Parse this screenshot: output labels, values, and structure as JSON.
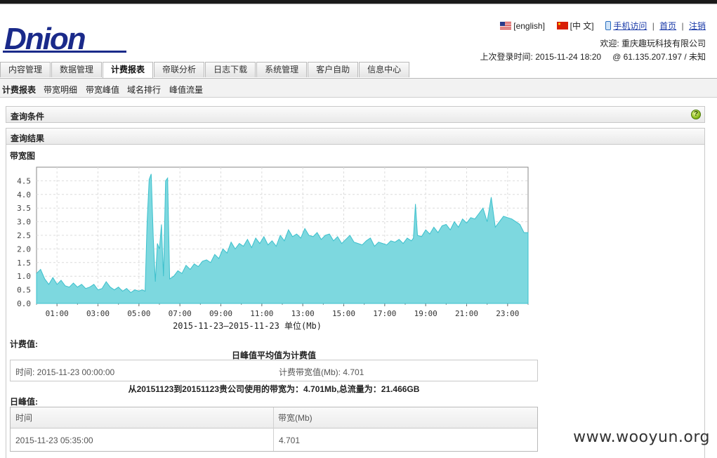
{
  "brand": {
    "logo_text": "Dnion"
  },
  "header": {
    "lang_english": "[english]",
    "lang_chinese": "[中 文]",
    "mobile": "手机访问",
    "home": "首页",
    "logout": "注销",
    "sep": "|",
    "welcome": "欢迎: 重庆趣玩科技有限公司",
    "last_login": "上次登录时间: 2015-11-24 18:20",
    "ip": "@ 61.135.207.197 / 未知"
  },
  "tabs": [
    "内容管理",
    "数据管理",
    "计费报表",
    "帝联分析",
    "日志下载",
    "系统管理",
    "客户自助",
    "信息中心"
  ],
  "active_tab": 2,
  "subnav": [
    "计费报表",
    "带宽明细",
    "带宽峰值",
    "域名排行",
    "峰值流量"
  ],
  "panels": {
    "query": "查询条件",
    "result": "查询结果"
  },
  "labels": {
    "chart": "带宽图",
    "billing": "计费值:",
    "daily_peak": "日峰值:"
  },
  "billing": {
    "rule": "日峰值平均值为计费值",
    "time": "时间: 2015-11-23 00:00:00",
    "value": "计费带宽值(Mb): 4.701",
    "summary": "从20151123到20151123贵公司使用的带宽为：4.701Mb,总流量为：21.466GB"
  },
  "peak_table": {
    "headers": [
      "时间",
      "带宽(Mb)"
    ],
    "rows": [
      [
        "2015-11-23 05:35:00",
        "4.701"
      ]
    ]
  },
  "watermark": "www.wooyun.org",
  "colors": {
    "fill": "#7dd8df",
    "stroke": "#3cc0cc",
    "logo": "#1a2a8a",
    "link": "#1a3aa8"
  },
  "chart_data": {
    "type": "area",
    "xlabel": "2015-11-23—2015-11-23 单位(Mb)",
    "ylabel": "",
    "ylim": [
      0,
      5
    ],
    "xlim": [
      0,
      24
    ],
    "grid": true,
    "xticks": [
      "01:00",
      "03:00",
      "05:00",
      "07:00",
      "09:00",
      "11:00",
      "13:00",
      "15:00",
      "17:00",
      "19:00",
      "21:00",
      "23:00"
    ],
    "yticks": [
      "0.0",
      "0.5",
      "1.0",
      "1.5",
      "2.0",
      "2.5",
      "3.0",
      "3.5",
      "4.0",
      "4.5"
    ],
    "series": [
      {
        "x": [
          0,
          0.2,
          0.4,
          0.6,
          0.8,
          1,
          1.2,
          1.4,
          1.6,
          1.8,
          2,
          2.2,
          2.4,
          2.6,
          2.8,
          3,
          3.2,
          3.4,
          3.6,
          3.8,
          4,
          4.2,
          4.4,
          4.6,
          4.8,
          5,
          5.15,
          5.3,
          5.4,
          5.5,
          5.6,
          5.7,
          5.8,
          5.9,
          6.0,
          6.1,
          6.2,
          6.3,
          6.4,
          6.5,
          6.7,
          6.9,
          7.1,
          7.3,
          7.5,
          7.7,
          7.9,
          8.1,
          8.3,
          8.5,
          8.7,
          8.9,
          9.1,
          9.3,
          9.5,
          9.7,
          9.9,
          10.1,
          10.3,
          10.5,
          10.7,
          10.9,
          11.1,
          11.3,
          11.5,
          11.7,
          11.9,
          12.1,
          12.3,
          12.5,
          12.7,
          12.9,
          13.1,
          13.3,
          13.5,
          13.7,
          13.9,
          14.1,
          14.3,
          14.5,
          14.7,
          14.9,
          15.1,
          15.3,
          15.5,
          15.7,
          15.9,
          16.1,
          16.3,
          16.5,
          16.7,
          16.9,
          17.1,
          17.3,
          17.5,
          17.7,
          17.9,
          18.1,
          18.3,
          18.4,
          18.5,
          18.6,
          18.8,
          19.0,
          19.2,
          19.4,
          19.6,
          19.8,
          20.0,
          20.2,
          20.4,
          20.6,
          20.8,
          21.0,
          21.2,
          21.4,
          21.6,
          21.8,
          22.0,
          22.2,
          22.4,
          22.6,
          22.8,
          23.0,
          23.2,
          23.4,
          23.6,
          23.8,
          24.0
        ],
        "y": [
          1.1,
          1.25,
          0.9,
          0.7,
          0.95,
          0.7,
          0.85,
          0.65,
          0.6,
          0.75,
          0.6,
          0.7,
          0.55,
          0.6,
          0.7,
          0.5,
          0.55,
          0.8,
          0.6,
          0.5,
          0.6,
          0.45,
          0.55,
          0.4,
          0.5,
          0.45,
          0.5,
          0.45,
          3.0,
          4.55,
          4.75,
          2.4,
          0.8,
          2.2,
          2.0,
          2.9,
          1.0,
          4.5,
          4.6,
          0.9,
          1.0,
          1.2,
          1.1,
          1.4,
          1.25,
          1.45,
          1.35,
          1.55,
          1.6,
          1.5,
          1.8,
          1.65,
          2.0,
          1.85,
          2.25,
          2.0,
          2.2,
          2.1,
          2.35,
          2.05,
          2.4,
          2.2,
          2.45,
          2.15,
          2.3,
          2.1,
          2.5,
          2.3,
          2.7,
          2.45,
          2.55,
          2.4,
          2.75,
          2.5,
          2.45,
          2.6,
          2.35,
          2.5,
          2.55,
          2.3,
          2.45,
          2.2,
          2.35,
          2.5,
          2.25,
          2.2,
          2.15,
          2.3,
          2.4,
          2.1,
          2.25,
          2.2,
          2.15,
          2.3,
          2.25,
          2.35,
          2.2,
          2.4,
          2.3,
          2.4,
          3.65,
          2.5,
          2.45,
          2.7,
          2.55,
          2.8,
          2.6,
          2.85,
          2.9,
          2.7,
          3.0,
          2.8,
          3.1,
          2.95,
          3.15,
          3.1,
          3.3,
          3.5,
          3.0,
          3.9,
          2.8,
          3.0,
          3.2,
          3.15,
          3.1,
          3.0,
          2.9,
          2.6,
          2.6
        ]
      }
    ]
  }
}
